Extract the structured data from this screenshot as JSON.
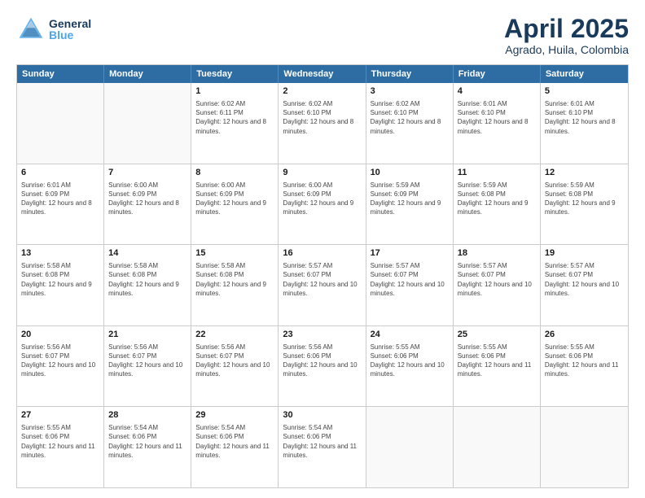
{
  "header": {
    "logo": {
      "general": "General",
      "blue": "Blue"
    },
    "title": "April 2025",
    "subtitle": "Agrado, Huila, Colombia"
  },
  "calendar": {
    "days_of_week": [
      "Sunday",
      "Monday",
      "Tuesday",
      "Wednesday",
      "Thursday",
      "Friday",
      "Saturday"
    ],
    "weeks": [
      [
        {
          "day": "",
          "empty": true
        },
        {
          "day": "",
          "empty": true
        },
        {
          "day": "1",
          "sunrise": "6:02 AM",
          "sunset": "6:11 PM",
          "daylight": "12 hours and 8 minutes."
        },
        {
          "day": "2",
          "sunrise": "6:02 AM",
          "sunset": "6:10 PM",
          "daylight": "12 hours and 8 minutes."
        },
        {
          "day": "3",
          "sunrise": "6:02 AM",
          "sunset": "6:10 PM",
          "daylight": "12 hours and 8 minutes."
        },
        {
          "day": "4",
          "sunrise": "6:01 AM",
          "sunset": "6:10 PM",
          "daylight": "12 hours and 8 minutes."
        },
        {
          "day": "5",
          "sunrise": "6:01 AM",
          "sunset": "6:10 PM",
          "daylight": "12 hours and 8 minutes."
        }
      ],
      [
        {
          "day": "6",
          "sunrise": "6:01 AM",
          "sunset": "6:09 PM",
          "daylight": "12 hours and 8 minutes."
        },
        {
          "day": "7",
          "sunrise": "6:00 AM",
          "sunset": "6:09 PM",
          "daylight": "12 hours and 8 minutes."
        },
        {
          "day": "8",
          "sunrise": "6:00 AM",
          "sunset": "6:09 PM",
          "daylight": "12 hours and 9 minutes."
        },
        {
          "day": "9",
          "sunrise": "6:00 AM",
          "sunset": "6:09 PM",
          "daylight": "12 hours and 9 minutes."
        },
        {
          "day": "10",
          "sunrise": "5:59 AM",
          "sunset": "6:09 PM",
          "daylight": "12 hours and 9 minutes."
        },
        {
          "day": "11",
          "sunrise": "5:59 AM",
          "sunset": "6:08 PM",
          "daylight": "12 hours and 9 minutes."
        },
        {
          "day": "12",
          "sunrise": "5:59 AM",
          "sunset": "6:08 PM",
          "daylight": "12 hours and 9 minutes."
        }
      ],
      [
        {
          "day": "13",
          "sunrise": "5:58 AM",
          "sunset": "6:08 PM",
          "daylight": "12 hours and 9 minutes."
        },
        {
          "day": "14",
          "sunrise": "5:58 AM",
          "sunset": "6:08 PM",
          "daylight": "12 hours and 9 minutes."
        },
        {
          "day": "15",
          "sunrise": "5:58 AM",
          "sunset": "6:08 PM",
          "daylight": "12 hours and 9 minutes."
        },
        {
          "day": "16",
          "sunrise": "5:57 AM",
          "sunset": "6:07 PM",
          "daylight": "12 hours and 10 minutes."
        },
        {
          "day": "17",
          "sunrise": "5:57 AM",
          "sunset": "6:07 PM",
          "daylight": "12 hours and 10 minutes."
        },
        {
          "day": "18",
          "sunrise": "5:57 AM",
          "sunset": "6:07 PM",
          "daylight": "12 hours and 10 minutes."
        },
        {
          "day": "19",
          "sunrise": "5:57 AM",
          "sunset": "6:07 PM",
          "daylight": "12 hours and 10 minutes."
        }
      ],
      [
        {
          "day": "20",
          "sunrise": "5:56 AM",
          "sunset": "6:07 PM",
          "daylight": "12 hours and 10 minutes."
        },
        {
          "day": "21",
          "sunrise": "5:56 AM",
          "sunset": "6:07 PM",
          "daylight": "12 hours and 10 minutes."
        },
        {
          "day": "22",
          "sunrise": "5:56 AM",
          "sunset": "6:07 PM",
          "daylight": "12 hours and 10 minutes."
        },
        {
          "day": "23",
          "sunrise": "5:56 AM",
          "sunset": "6:06 PM",
          "daylight": "12 hours and 10 minutes."
        },
        {
          "day": "24",
          "sunrise": "5:55 AM",
          "sunset": "6:06 PM",
          "daylight": "12 hours and 10 minutes."
        },
        {
          "day": "25",
          "sunrise": "5:55 AM",
          "sunset": "6:06 PM",
          "daylight": "12 hours and 11 minutes."
        },
        {
          "day": "26",
          "sunrise": "5:55 AM",
          "sunset": "6:06 PM",
          "daylight": "12 hours and 11 minutes."
        }
      ],
      [
        {
          "day": "27",
          "sunrise": "5:55 AM",
          "sunset": "6:06 PM",
          "daylight": "12 hours and 11 minutes."
        },
        {
          "day": "28",
          "sunrise": "5:54 AM",
          "sunset": "6:06 PM",
          "daylight": "12 hours and 11 minutes."
        },
        {
          "day": "29",
          "sunrise": "5:54 AM",
          "sunset": "6:06 PM",
          "daylight": "12 hours and 11 minutes."
        },
        {
          "day": "30",
          "sunrise": "5:54 AM",
          "sunset": "6:06 PM",
          "daylight": "12 hours and 11 minutes."
        },
        {
          "day": "",
          "empty": true
        },
        {
          "day": "",
          "empty": true
        },
        {
          "day": "",
          "empty": true
        }
      ]
    ]
  }
}
